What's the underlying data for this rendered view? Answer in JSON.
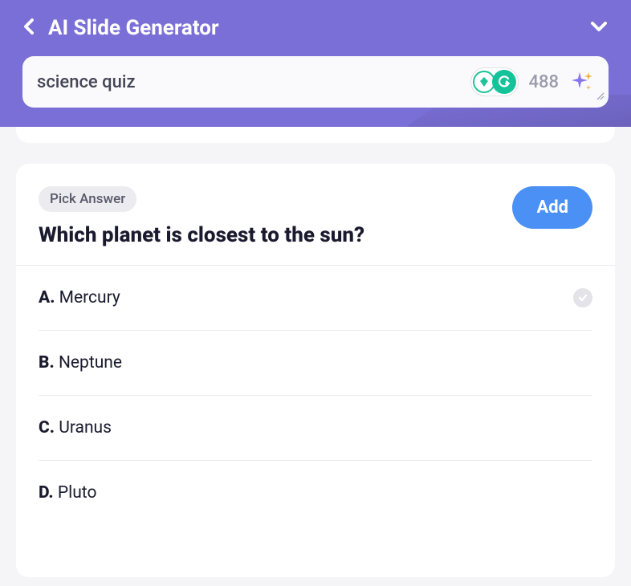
{
  "header": {
    "title": "AI Slide Generator"
  },
  "input": {
    "value": "science quiz",
    "counter": "488"
  },
  "card": {
    "badge": "Pick Answer",
    "question": "Which planet is closest to the sun?",
    "add_button": "Add",
    "answers": [
      {
        "letter": "A.",
        "text": "Mercury",
        "correct": true
      },
      {
        "letter": "B.",
        "text": "Neptune",
        "correct": false
      },
      {
        "letter": "C.",
        "text": "Uranus",
        "correct": false
      },
      {
        "letter": "D.",
        "text": "Pluto",
        "correct": false
      }
    ]
  }
}
